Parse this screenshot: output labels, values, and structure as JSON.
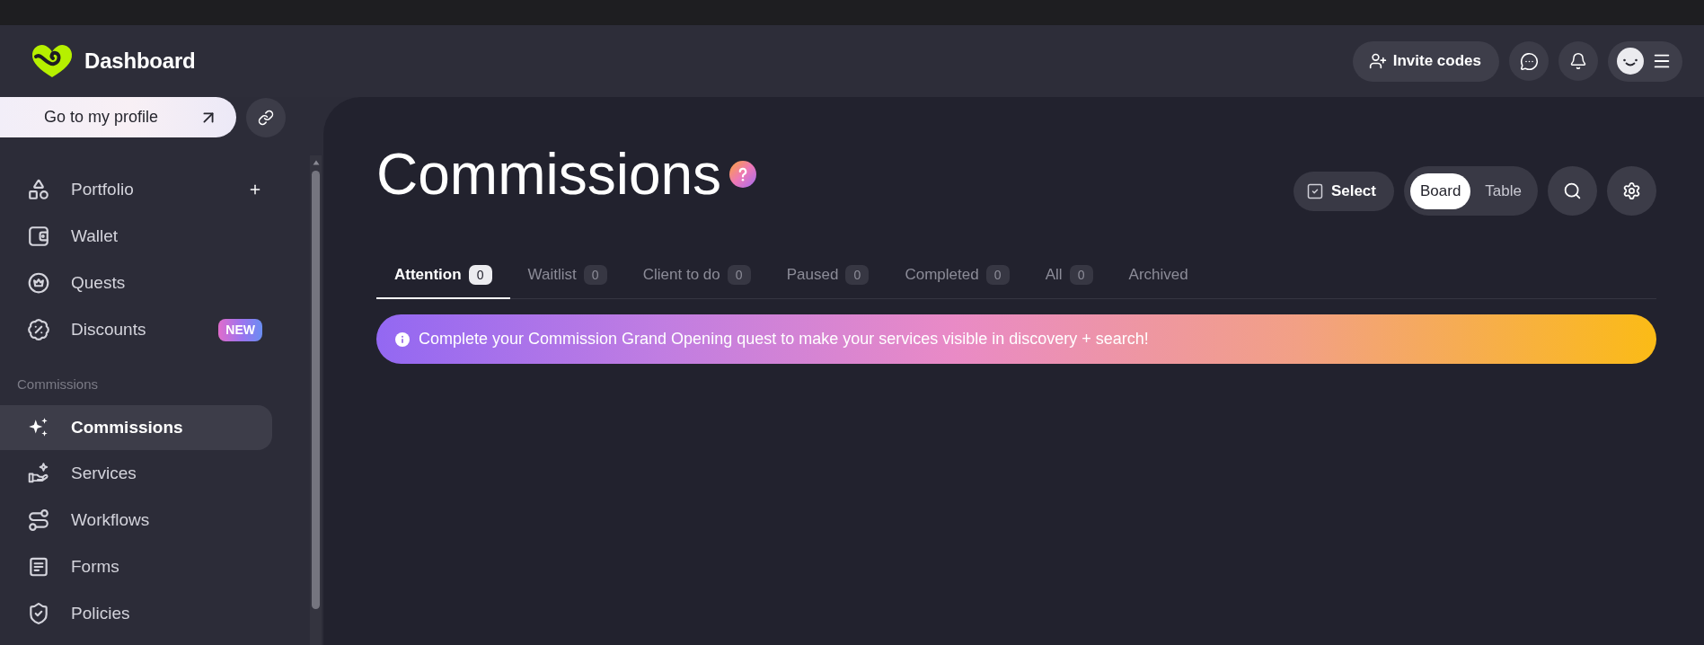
{
  "header": {
    "brand": "Dashboard",
    "invite_button": "Invite codes"
  },
  "sidebar": {
    "profile_button": "Go to my profile",
    "items": [
      {
        "label": "Portfolio",
        "selected": false,
        "add_button": true
      },
      {
        "label": "Wallet",
        "selected": false,
        "add_button": false
      },
      {
        "label": "Quests",
        "selected": false,
        "add_button": false
      },
      {
        "label": "Discounts",
        "selected": false,
        "add_button": false,
        "badge": "NEW"
      }
    ],
    "sections": [
      {
        "title": "Commissions",
        "items": [
          {
            "label": "Commissions",
            "selected": true
          },
          {
            "label": "Services",
            "selected": false
          },
          {
            "label": "Workflows",
            "selected": false
          },
          {
            "label": "Forms",
            "selected": false
          },
          {
            "label": "Policies",
            "selected": false
          }
        ]
      }
    ]
  },
  "page": {
    "title": "Commissions",
    "select_button": "Select"
  },
  "view_options": [
    {
      "label": "Board",
      "selected": true
    },
    {
      "label": "Table",
      "selected": false
    }
  ],
  "tabs": [
    {
      "label": "Attention",
      "count": "0",
      "selected": true
    },
    {
      "label": "Waitlist",
      "count": "0",
      "selected": false
    },
    {
      "label": "Client to do",
      "count": "0",
      "selected": false
    },
    {
      "label": "Paused",
      "count": "0",
      "selected": false
    },
    {
      "label": "Completed",
      "count": "0",
      "selected": false
    },
    {
      "label": "All",
      "count": "0",
      "selected": false
    },
    {
      "label": "Archived",
      "selected": false
    }
  ],
  "banner": {
    "text": "Complete your Commission Grand Opening quest to make your services visible in discovery + search!"
  }
}
